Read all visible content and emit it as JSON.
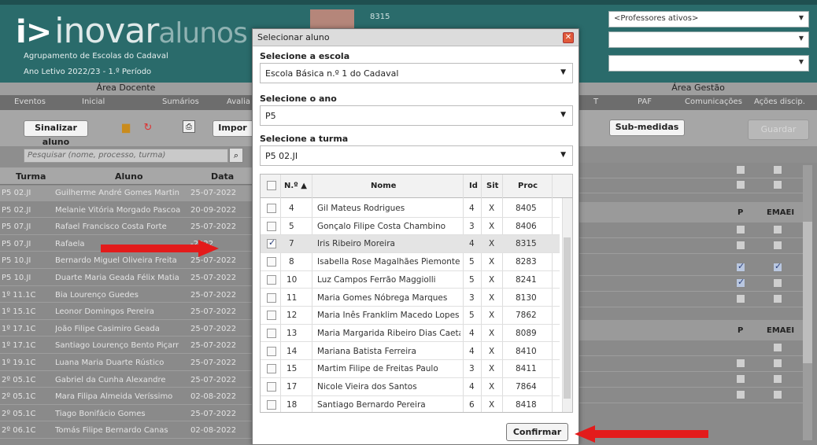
{
  "header": {
    "logo": {
      "main": "inovar",
      "accent": "alunos"
    },
    "school": "Agrupamento de Escolas do Cadaval",
    "year": "Ano Letivo 2022/23 - 1.º Período",
    "user_number": "8315",
    "selects": [
      {
        "value": "<Professores ativos>"
      },
      {
        "value": ""
      },
      {
        "value": ""
      }
    ]
  },
  "areas": {
    "docente": "Área Docente",
    "gestao": "Área Gestão"
  },
  "nav_left": [
    "Eventos",
    "Inicial",
    "Sumários",
    "Avalia"
  ],
  "nav_right": [
    "T",
    "PAF",
    "Comunicações",
    "Ações discip."
  ],
  "toolbar": {
    "sinalizar": "Sinalizar aluno",
    "importar": "Impor",
    "submedidas": "Sub-medidas",
    "guardar": "Guardar",
    "search_placeholder": "Pesquisar (nome, processo, turma)"
  },
  "left_table": {
    "headers": {
      "turma": "Turma",
      "aluno": "Aluno",
      "data": "Data"
    },
    "rows": [
      {
        "turma": "P5 02.JI",
        "aluno": "Guilherme André Gomes Martin",
        "data": "25-07-2022"
      },
      {
        "turma": "P5 02.JI",
        "aluno": "Melanie Vitória Morgado Pascoa",
        "data": "20-09-2022"
      },
      {
        "turma": "P5 07.JI",
        "aluno": "Rafael Francisco Costa Forte",
        "data": "25-07-2022"
      },
      {
        "turma": "P5 07.JI",
        "aluno": "Rafaela",
        "data": "-2022"
      },
      {
        "turma": "P5 10.JI",
        "aluno": "Bernardo Miguel Oliveira Freita",
        "data": "25-07-2022"
      },
      {
        "turma": "P5 10.JI",
        "aluno": "Duarte Maria Geada Félix Matia",
        "data": "25-07-2022"
      },
      {
        "turma": "1º 11.1C",
        "aluno": "Bia Lourenço Guedes",
        "data": "25-07-2022"
      },
      {
        "turma": "1º 15.1C",
        "aluno": "Leonor Domingos Pereira",
        "data": "25-07-2022"
      },
      {
        "turma": "1º 17.1C",
        "aluno": "João Filipe Casimiro Geada",
        "data": "25-07-2022"
      },
      {
        "turma": "1º 17.1C",
        "aluno": "Santiago Lourenço Bento Piçarr",
        "data": "25-07-2022"
      },
      {
        "turma": "1º 19.1C",
        "aluno": "Luana Maria Duarte Rústico",
        "data": "25-07-2022"
      },
      {
        "turma": "2º 05.1C",
        "aluno": "Gabriel da Cunha Alexandre",
        "data": "25-07-2022"
      },
      {
        "turma": "2º 05.1C",
        "aluno": "Mara Filipa Almeida Veríssimo",
        "data": "02-08-2022"
      },
      {
        "turma": "2º 05.1C",
        "aluno": "Tiago Bonifácio Gomes",
        "data": "25-07-2022"
      },
      {
        "turma": "2º 06.1C",
        "aluno": "Tomás Filipe Bernardo Canas",
        "data": "02-08-2022"
      }
    ]
  },
  "right_panel": {
    "col_p": "P",
    "col_emaei": "EMAEI"
  },
  "modal": {
    "title": "Selecionar aluno",
    "escola_label": "Selecione a escola",
    "escola_value": "Escola Básica n.º 1 do Cadaval",
    "ano_label": "Selecione o ano",
    "ano_value": "P5",
    "turma_label": "Selecione a turma",
    "turma_value": "P5 02.JI",
    "table": {
      "headers": {
        "num": "N.º ▲",
        "nome": "Nome",
        "id": "Id",
        "sit": "Sit",
        "proc": "Proc"
      },
      "rows": [
        {
          "num": "4",
          "nome": "Gil Mateus Rodrigues",
          "id": "4",
          "sit": "X",
          "proc": "8405",
          "checked": false
        },
        {
          "num": "5",
          "nome": "Gonçalo Filipe Costa Chambino",
          "id": "3",
          "sit": "X",
          "proc": "8406",
          "checked": false
        },
        {
          "num": "7",
          "nome": "Iris Ribeiro Moreira",
          "id": "4",
          "sit": "X",
          "proc": "8315",
          "checked": true
        },
        {
          "num": "8",
          "nome": "Isabella Rose Magalhães Piemonte",
          "id": "5",
          "sit": "X",
          "proc": "8283",
          "checked": false
        },
        {
          "num": "10",
          "nome": "Luz Campos Ferrão Maggiolli",
          "id": "5",
          "sit": "X",
          "proc": "8241",
          "checked": false
        },
        {
          "num": "11",
          "nome": "Maria Gomes Nóbrega Marques",
          "id": "3",
          "sit": "X",
          "proc": "8130",
          "checked": false
        },
        {
          "num": "12",
          "nome": "Maria Inês Franklim Macedo Lopes",
          "id": "5",
          "sit": "X",
          "proc": "7862",
          "checked": false
        },
        {
          "num": "13",
          "nome": "Maria Margarida Ribeiro Dias Caetan",
          "id": "4",
          "sit": "X",
          "proc": "8089",
          "checked": false
        },
        {
          "num": "14",
          "nome": "Mariana Batista Ferreira",
          "id": "4",
          "sit": "X",
          "proc": "8410",
          "checked": false
        },
        {
          "num": "15",
          "nome": "Martim Filipe de Freitas Paulo",
          "id": "3",
          "sit": "X",
          "proc": "8411",
          "checked": false
        },
        {
          "num": "17",
          "nome": "Nicole Vieira dos Santos",
          "id": "4",
          "sit": "X",
          "proc": "7864",
          "checked": false
        },
        {
          "num": "18",
          "nome": "Santiago Bernardo Pereira",
          "id": "6",
          "sit": "X",
          "proc": "8418",
          "checked": false
        }
      ]
    },
    "confirm": "Confirmar"
  },
  "colors": {
    "header_bg": "#2a6b6b",
    "highlight_arrow": "#e31b1b"
  }
}
